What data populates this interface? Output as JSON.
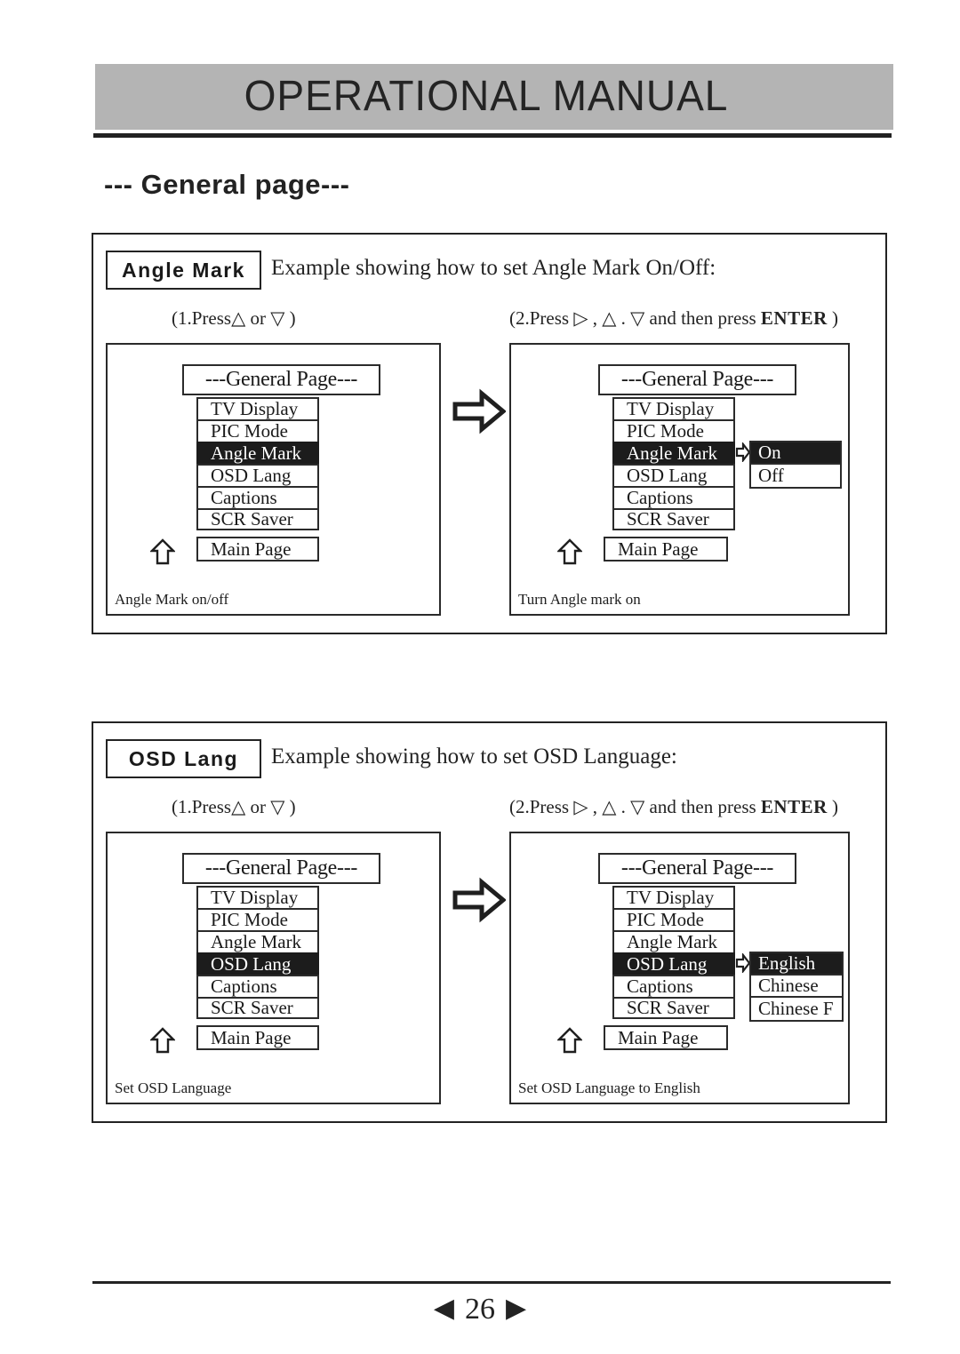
{
  "header": {
    "title": "OPERATIONAL MANUAL",
    "page_heading": "--- General  page---"
  },
  "sections": [
    {
      "badge": "Angle Mark",
      "description": "Example showing how to set Angle Mark On/Off:",
      "step1_caption": "(1.Press△ or ▽ )",
      "step2_caption_prefix": "(2.Press ▷ , △ . ▽ and then press ",
      "step2_caption_bold": "ENTER",
      "step2_caption_suffix": " )",
      "left_screen": {
        "osd_title": "---General Page---",
        "items": [
          "TV Display",
          "PIC Mode",
          "Angle Mark",
          "OSD Lang",
          "Captions",
          "SCR Saver"
        ],
        "selected_index": 2,
        "main_page_label": "Main Page",
        "footer": "Angle Mark on/off"
      },
      "right_screen": {
        "osd_title": "---General Page---",
        "items": [
          "TV Display",
          "PIC Mode",
          "Angle Mark",
          "OSD Lang",
          "Captions",
          "SCR Saver"
        ],
        "selected_index": 2,
        "submenu": {
          "options": [
            "On",
            "Off"
          ],
          "selected_index": 0
        },
        "main_page_label": "Main Page",
        "footer": "Turn Angle mark on"
      }
    },
    {
      "badge": "OSD  Lang",
      "description": "Example showing how to set OSD Language:",
      "step1_caption": "(1.Press△ or ▽ )",
      "step2_caption_prefix": "(2.Press ▷ , △ . ▽ and then press ",
      "step2_caption_bold": "ENTER",
      "step2_caption_suffix": " )",
      "left_screen": {
        "osd_title": "---General Page---",
        "items": [
          "TV Display",
          "PIC Mode",
          "Angle Mark",
          "OSD Lang",
          "Captions",
          "SCR Saver"
        ],
        "selected_index": 3,
        "main_page_label": "Main Page",
        "footer": "Set OSD Language"
      },
      "right_screen": {
        "osd_title": "---General Page---",
        "items": [
          "TV Display",
          "PIC Mode",
          "Angle Mark",
          "OSD Lang",
          "Captions",
          "SCR Saver"
        ],
        "selected_index": 3,
        "submenu": {
          "options": [
            "English",
            "Chinese",
            "Chinese F"
          ],
          "selected_index": 0
        },
        "main_page_label": "Main Page",
        "footer": "Set OSD Language to English"
      }
    }
  ],
  "footer": {
    "prev_icon": "◀",
    "page_number": "26",
    "next_icon": "▶"
  },
  "colors": {
    "header_band": "#b4b4b4",
    "ink": "#232323",
    "highlight": "#1c1c1c"
  }
}
